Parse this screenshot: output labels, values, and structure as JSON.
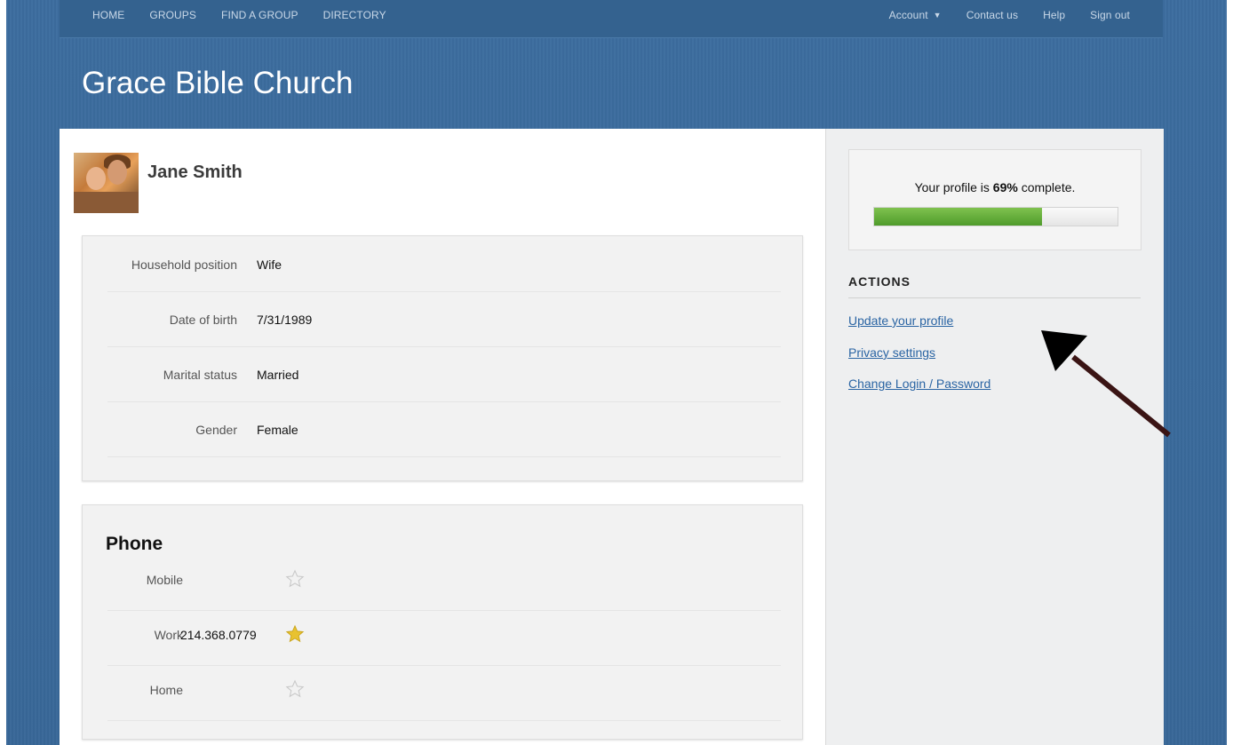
{
  "nav": {
    "left": [
      "HOME",
      "GROUPS",
      "FIND A GROUP",
      "DIRECTORY"
    ],
    "account": "Account",
    "right": [
      "Contact us",
      "Help",
      "Sign out"
    ]
  },
  "site_title": "Grace Bible Church",
  "profile": {
    "name": "Jane Smith",
    "details": [
      {
        "label": "Household position",
        "value": "Wife"
      },
      {
        "label": "Date of birth",
        "value": "7/31/1989"
      },
      {
        "label": "Marital status",
        "value": "Married"
      },
      {
        "label": "Gender",
        "value": "Female"
      }
    ]
  },
  "phone": {
    "title": "Phone",
    "rows": [
      {
        "label": "Mobile",
        "value": "",
        "primary": false
      },
      {
        "label": "Work",
        "value": "214.368.0779",
        "primary": true
      },
      {
        "label": "Home",
        "value": "",
        "primary": false
      }
    ]
  },
  "progress": {
    "prefix": "Your profile is ",
    "percent_text": "69%",
    "suffix": " complete.",
    "fraction": 0.69,
    "fill_color": "#5faa37"
  },
  "actions": {
    "heading": "ACTIONS",
    "links": [
      "Update your profile",
      "Privacy settings",
      "Change Login / Password"
    ]
  },
  "colors": {
    "background": "#3a6a9b",
    "link": "#2a64a3",
    "star_active": "#e8c230",
    "arrow": "#3a1414"
  }
}
